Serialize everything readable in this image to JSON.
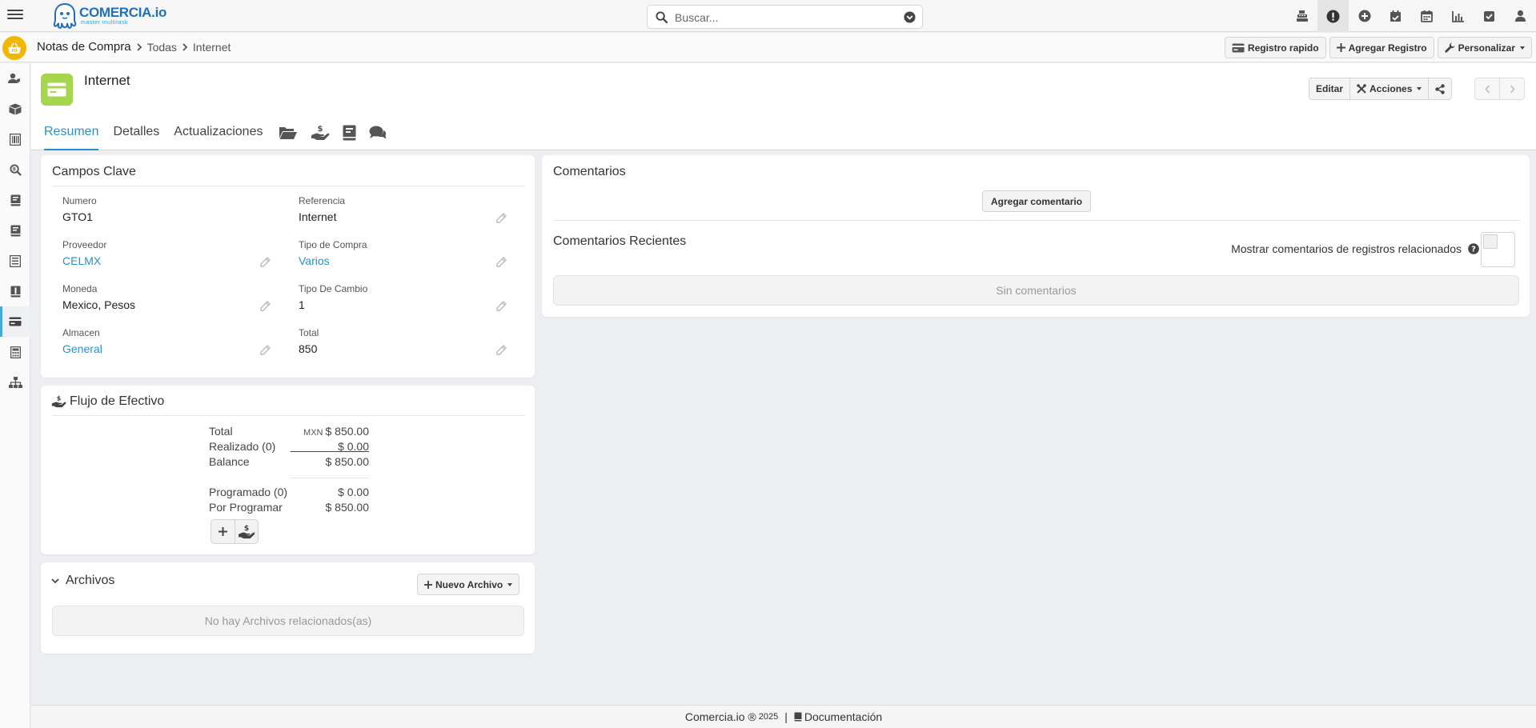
{
  "brand": {
    "name": "COMERCIA.io",
    "tagline": "master multitask"
  },
  "search": {
    "placeholder": "Buscar..."
  },
  "topbar_icons": [
    "cash-register-icon",
    "exclamation-circle-icon",
    "plus-circle-icon",
    "calendar-check-icon",
    "calendar-icon",
    "chart-icon",
    "check-square-icon",
    "user-icon"
  ],
  "breadcrumb": {
    "module": "Notas de Compra",
    "list": "Todas",
    "current": "Internet"
  },
  "toolbar": {
    "quick_label": "Registro rapido",
    "add_label": "Agregar Registro",
    "customize_label": "Personalizar"
  },
  "sidebar_icons": [
    "users-icon",
    "box-icon",
    "barcode-icon",
    "search-icon",
    "book-icon",
    "book-icon",
    "list-icon",
    "book-icon",
    "credit-card-icon",
    "calculator-icon",
    "sitemap-icon"
  ],
  "record": {
    "title": "Internet",
    "edit_label": "Editar",
    "actions_label": "Acciones",
    "tabs": {
      "summary": "Resumen",
      "details": "Detalles",
      "updates": "Actualizaciones"
    }
  },
  "key_fields": {
    "title": "Campos Clave",
    "numero": {
      "label": "Numero",
      "value": "GTO1"
    },
    "referencia": {
      "label": "Referencia",
      "value": "Internet"
    },
    "proveedor": {
      "label": "Proveedor",
      "value": "CELMX"
    },
    "tipo_compra": {
      "label": "Tipo de Compra",
      "value": "Varios"
    },
    "moneda": {
      "label": "Moneda",
      "value": "Mexico, Pesos"
    },
    "tipo_cambio": {
      "label": "Tipo De Cambio",
      "value": "1"
    },
    "almacen": {
      "label": "Almacen",
      "value": "General"
    },
    "total": {
      "label": "Total",
      "value": "850"
    }
  },
  "cash_flow": {
    "title": "Flujo de Efectivo",
    "total": {
      "label": "Total",
      "currency": "MXN",
      "value": "$ 850.00"
    },
    "realizado": {
      "label": "Realizado (0)",
      "value": "$ 0.00"
    },
    "balance": {
      "label": "Balance",
      "value": "$ 850.00"
    },
    "programado": {
      "label": "Programado (0)",
      "value": "$ 0.00"
    },
    "por_programar": {
      "label": "Por Programar",
      "value": "$ 850.00"
    }
  },
  "files": {
    "title": "Archivos",
    "new_label": "Nuevo Archivo",
    "empty": "No hay Archivos relacionados(as)"
  },
  "comments": {
    "title": "Comentarios",
    "add_label": "Agregar comentario",
    "recent_title": "Comentarios Recientes",
    "related_label": "Mostrar comentarios de registros relacionados",
    "related_enabled": false,
    "empty": "Sin comentarios"
  },
  "footer": {
    "brand": "Comercia.io ®",
    "year": "2025",
    "separator": "|",
    "docs": "Documentación"
  },
  "colors": {
    "accent": "#2d8fc7",
    "home": "#f2b705",
    "record_icon": "#a6d64e"
  }
}
